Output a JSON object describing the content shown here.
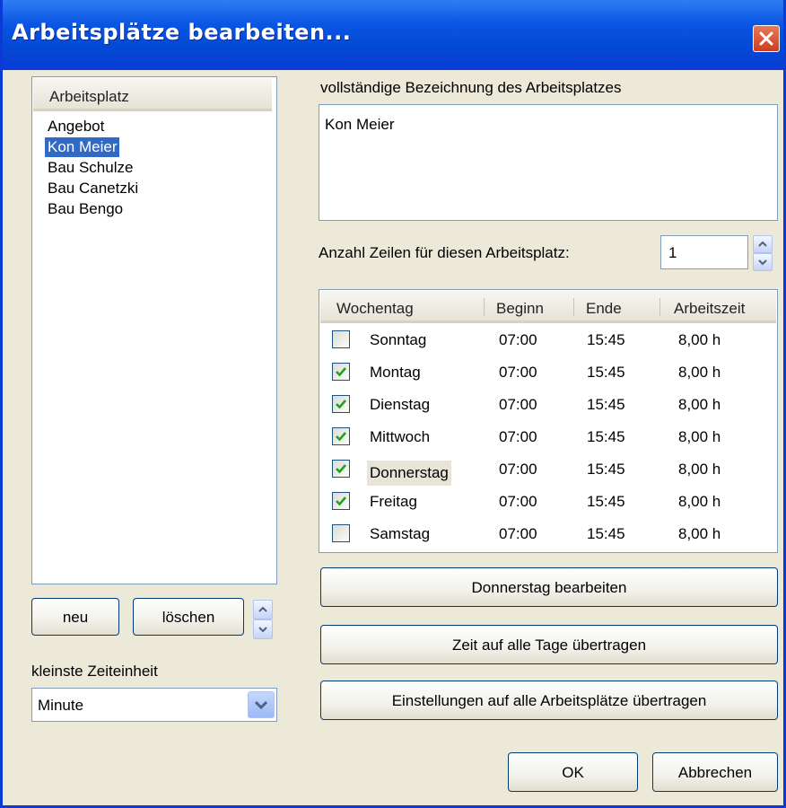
{
  "window": {
    "title": "Arbeitsplätze bearbeiten..."
  },
  "left": {
    "list_header": "Arbeitsplatz",
    "items": [
      "Angebot",
      "Kon Meier",
      "Bau Schulze",
      "Bau Canetzki",
      "Bau Bengo"
    ],
    "selected_item": "Kon Meier",
    "new_button": "neu",
    "delete_button": "löschen",
    "time_unit_label": "kleinste Zeiteinheit",
    "time_unit_value": "Minute"
  },
  "right": {
    "description_label": "vollständige Bezeichnung des Arbeitsplatzes",
    "description_value": "Kon Meier",
    "rows_label": "Anzahl Zeilen für diesen Arbeitsplatz:",
    "rows_value": "1",
    "columns": [
      "Wochentag",
      "Beginn",
      "Ende",
      "Arbeitszeit"
    ],
    "days": [
      {
        "day": "Sonntag",
        "checked": false,
        "start": "07:00",
        "end": "15:45",
        "hours": "8,00 h"
      },
      {
        "day": "Montag",
        "checked": true,
        "start": "07:00",
        "end": "15:45",
        "hours": "8,00 h"
      },
      {
        "day": "Dienstag",
        "checked": true,
        "start": "07:00",
        "end": "15:45",
        "hours": "8,00 h"
      },
      {
        "day": "Mittwoch",
        "checked": true,
        "start": "07:00",
        "end": "15:45",
        "hours": "8,00 h"
      },
      {
        "day": "Donnerstag",
        "checked": true,
        "start": "07:00",
        "end": "15:45",
        "hours": "8,00 h"
      },
      {
        "day": "Freitag",
        "checked": true,
        "start": "07:00",
        "end": "15:45",
        "hours": "8,00 h"
      },
      {
        "day": "Samstag",
        "checked": false,
        "start": "07:00",
        "end": "15:45",
        "hours": "8,00 h"
      }
    ],
    "selected_day": "Donnerstag",
    "edit_day_button": "Donnerstag bearbeiten",
    "copy_time_button": "Zeit auf alle Tage übertragen",
    "copy_settings_button": "Einstellungen auf alle Arbeitsplätze übertragen"
  },
  "footer": {
    "ok_button": "OK",
    "cancel_button": "Abbrechen"
  },
  "colors": {
    "title_bar": "#0a55e3",
    "selection": "#316ac5",
    "check": "#21a121",
    "close_button": "#d6512e"
  }
}
